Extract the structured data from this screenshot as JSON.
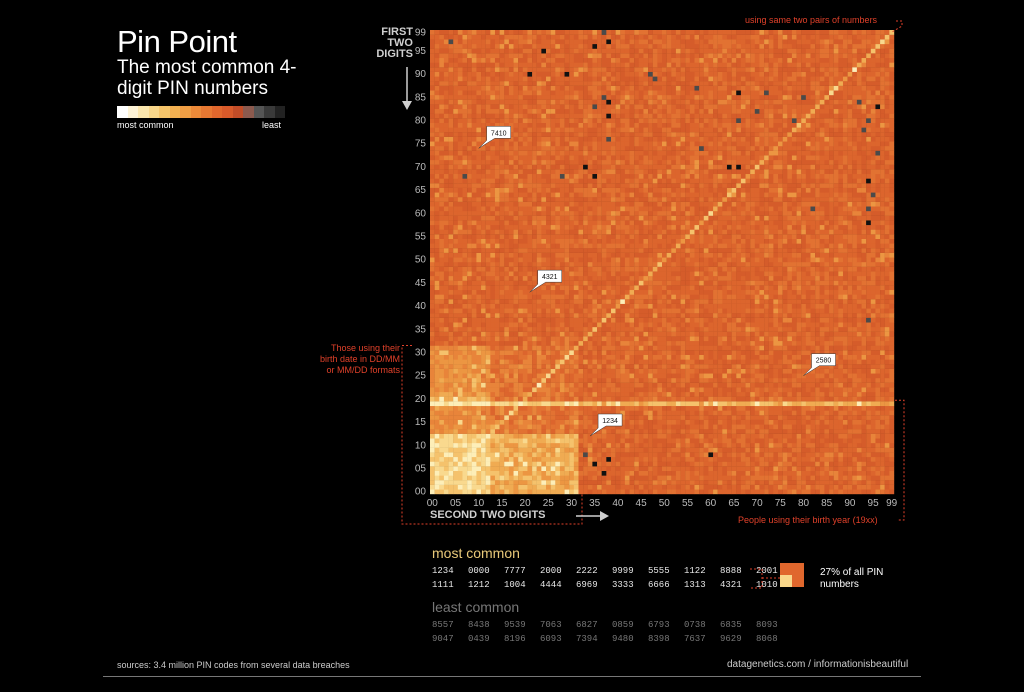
{
  "header": {
    "title": "Pin Point",
    "subtitle": "The most common 4-digit PIN numbers"
  },
  "legend": {
    "most_label": "most common",
    "least_label": "least",
    "colors": [
      "#ffffff",
      "#fdf3d6",
      "#fbe6ad",
      "#f9d78a",
      "#f6c56a",
      "#f3b152",
      "#f09e44",
      "#ec8a39",
      "#e77832",
      "#e0672d",
      "#d85a2a",
      "#c24d28",
      "#8c5a4e",
      "#555555",
      "#3a3a3a",
      "#222222"
    ]
  },
  "annotations": {
    "pairs_note": "using same two pairs of numbers",
    "birthdate_note": "Those using their birth date in DD/MM or MM/DD formats",
    "birthyear_note": "People using their birth year (19xx)"
  },
  "chart_data": {
    "type": "heatmap",
    "xlabel": "SECOND TWO DIGITS",
    "ylabel": "FIRST TWO DIGITS",
    "x_range": [
      0,
      99
    ],
    "y_range": [
      0,
      99
    ],
    "x_ticks": [
      "00",
      "05",
      "10",
      "15",
      "20",
      "25",
      "30",
      "35",
      "40",
      "45",
      "50",
      "55",
      "60",
      "65",
      "70",
      "75",
      "80",
      "85",
      "90",
      "95",
      "99"
    ],
    "y_ticks": [
      "99",
      "95",
      "90",
      "85",
      "80",
      "75",
      "70",
      "65",
      "60",
      "55",
      "50",
      "45",
      "40",
      "35",
      "30",
      "25",
      "20",
      "15",
      "10",
      "05",
      "00"
    ],
    "callouts": [
      {
        "label": "7410",
        "first": 74,
        "second": 10
      },
      {
        "label": "4321",
        "first": 43,
        "second": 21
      },
      {
        "label": "2580",
        "first": 25,
        "second": 80
      },
      {
        "label": "1234",
        "first": 12,
        "second": 34
      }
    ],
    "least_common_cells": [
      [
        97,
        4
      ],
      [
        95,
        24
      ],
      [
        96,
        35
      ],
      [
        99,
        37
      ],
      [
        97,
        38
      ],
      [
        90,
        29
      ],
      [
        89,
        48
      ],
      [
        90,
        47
      ],
      [
        87,
        57
      ],
      [
        86,
        66
      ],
      [
        86,
        72
      ],
      [
        85,
        80
      ],
      [
        83,
        35
      ],
      [
        85,
        37
      ],
      [
        84,
        38
      ],
      [
        81,
        38
      ],
      [
        80,
        66
      ],
      [
        82,
        70
      ],
      [
        80,
        78
      ],
      [
        84,
        92
      ],
      [
        83,
        96
      ],
      [
        80,
        94
      ],
      [
        78,
        93
      ],
      [
        76,
        38
      ],
      [
        74,
        58
      ],
      [
        70,
        33
      ],
      [
        68,
        35
      ],
      [
        68,
        28
      ],
      [
        68,
        7
      ],
      [
        70,
        64
      ],
      [
        70,
        66
      ],
      [
        67,
        94
      ],
      [
        64,
        95
      ],
      [
        61,
        94
      ],
      [
        61,
        82
      ],
      [
        58,
        94
      ],
      [
        37,
        94
      ],
      [
        8,
        33
      ],
      [
        7,
        38
      ],
      [
        4,
        37
      ],
      [
        8,
        60
      ],
      [
        6,
        35
      ],
      [
        90,
        21
      ],
      [
        73,
        96
      ]
    ]
  },
  "most_common": {
    "title": "most common",
    "row1": [
      "1234",
      "0000",
      "7777",
      "2000",
      "2222",
      "9999",
      "5555",
      "1122",
      "8888",
      "2001"
    ],
    "row2": [
      "1111",
      "1212",
      "1004",
      "4444",
      "6969",
      "3333",
      "6666",
      "1313",
      "4321",
      "1010"
    ],
    "share_text": "27% of all PIN numbers"
  },
  "least_common": {
    "title": "least common",
    "row1": [
      "8557",
      "8438",
      "9539",
      "7063",
      "6827",
      "0859",
      "6793",
      "0738",
      "6835",
      "8093"
    ],
    "row2": [
      "9047",
      "0439",
      "8196",
      "6093",
      "7394",
      "9480",
      "8398",
      "7637",
      "9629",
      "8068"
    ]
  },
  "footer": {
    "source": "sources: 3.4 million PIN codes from several data breaches",
    "credit": "datagenetics.com / informationisbeautiful"
  }
}
